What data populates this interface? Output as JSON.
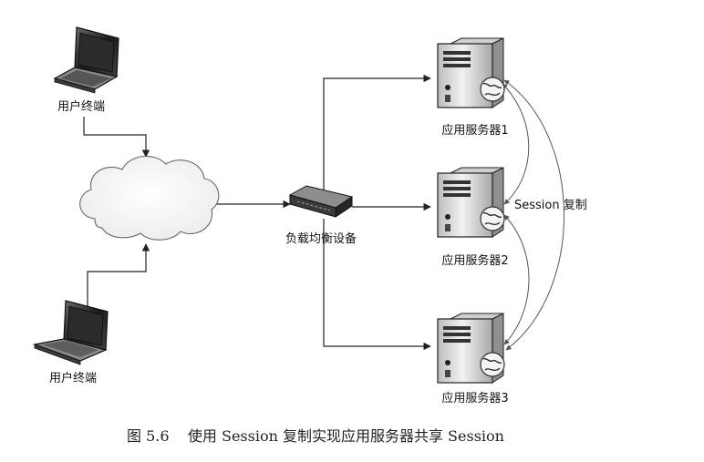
{
  "nodes": {
    "user_terminal_top": {
      "label": "用户终端"
    },
    "internet_cloud": {
      "label": ""
    },
    "user_terminal_bottom": {
      "label": "用户终端"
    },
    "load_balancer": {
      "label": "负载均衡设备"
    },
    "app_server_1": {
      "label": "应用服务器1"
    },
    "app_server_2": {
      "label": "应用服务器2"
    },
    "app_server_3": {
      "label": "应用服务器3"
    }
  },
  "edges": {
    "session_replication": {
      "label": "Session 复制"
    }
  },
  "caption": "图 5.6    使用 Session 复制实现应用服务器共享 Session",
  "colors": {
    "line": "#222222",
    "curve": "#555555",
    "device_dark": "#2a2a2a",
    "device_mid": "#6b6b6b",
    "device_light": "#d9d9d9"
  },
  "icons": {
    "terminal": "laptop-icon",
    "cloud": "cloud-icon",
    "balancer": "switch-icon",
    "server": "server-tower-icon",
    "globe": "globe-icon"
  }
}
